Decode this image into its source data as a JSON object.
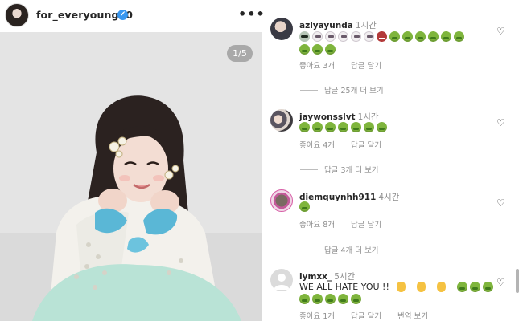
{
  "post": {
    "username": "for_everyoung10",
    "verified_mark": "✔",
    "more_label": "•••",
    "photo_counter": "1/5"
  },
  "comments": [
    {
      "username": "azlyayunda",
      "time": "1시간",
      "emoji_rows": [
        [
          "alien",
          "skull",
          "skull",
          "skull",
          "skull",
          "skull",
          "ogre",
          "nausea",
          "nausea",
          "nausea",
          "nausea",
          "nausea",
          "nausea"
        ],
        [
          "nausea",
          "nausea",
          "nausea"
        ]
      ],
      "likes": "좋아요 3개",
      "reply": "답글 달기",
      "more_replies": "답글 25개 더 보기"
    },
    {
      "username": "jaywonsslvt",
      "time": "1시간",
      "emoji_rows": [
        [
          "nausea",
          "nausea",
          "nausea",
          "nausea",
          "nausea",
          "nausea",
          "nausea"
        ]
      ],
      "likes": "좋아요 4개",
      "reply": "답글 달기",
      "more_replies": "답글 3개 더 보기"
    },
    {
      "username": "diemquynhh911",
      "time": "4시간",
      "emoji_rows": [
        [
          "nausea"
        ]
      ],
      "likes": "좋아요 8개",
      "reply": "답글 달기",
      "more_replies": "답글 4개 더 보기"
    },
    {
      "username": "lymxx_",
      "time": "5시간",
      "text": "WE ALL HATE YOU !!",
      "text_emojis": [
        "point",
        "point",
        "point",
        "nausea",
        "nausea",
        "nausea"
      ],
      "emoji_rows": [
        [
          "nausea",
          "nausea",
          "nausea",
          "nausea",
          "nausea"
        ]
      ],
      "likes": "좋아요 1개",
      "reply": "답글 달기",
      "translate": "번역 보기"
    }
  ],
  "icons": {
    "heart": "heart-icon",
    "avatar_placeholder": "default-avatar-icon"
  },
  "colors": {
    "text": "#262626",
    "muted": "#8e8e8e",
    "verified": "#3897f0",
    "nausea_emoji": "#7fb53d"
  }
}
